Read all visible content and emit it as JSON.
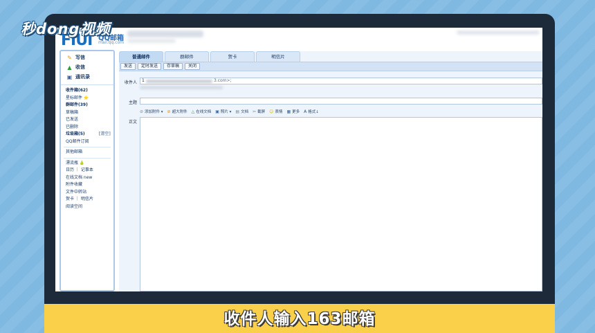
{
  "watermark": "秒dong视频",
  "header": {
    "logo_text": "FIUI",
    "logo_qq": "QQ邮箱",
    "logo_domain": "mail.qq.com"
  },
  "sidebar": {
    "actions": [
      {
        "label": "写信",
        "icon": "pen-icon"
      },
      {
        "label": "收信",
        "icon": "inbox-icon"
      },
      {
        "label": "通讯录",
        "icon": "contacts-icon"
      }
    ],
    "items": [
      {
        "label": "收件箱(62)",
        "bold": true
      },
      {
        "label": "星标邮件 ⭐",
        "bold": false
      },
      {
        "label": "群邮件(39)",
        "bold": true
      },
      {
        "label": "草稿箱",
        "bold": false
      },
      {
        "label": "已发送",
        "bold": false
      },
      {
        "label": "已删除",
        "bold": false
      },
      {
        "label": "垃圾箱(5)",
        "bold": true,
        "extra": "[清空]"
      },
      {
        "label": "QQ邮件订阅",
        "bold": false
      }
    ],
    "other_mailbox": "其他邮箱",
    "tools": [
      {
        "label": "漂流瓶 🍐"
      },
      {
        "label": "日历 ｜ 记事本"
      },
      {
        "label": "在线文档 new"
      },
      {
        "label": "附件收藏"
      },
      {
        "label": "文件中转站"
      },
      {
        "label": "贺卡 ｜ 明信片"
      },
      {
        "label": "阅读空间"
      }
    ]
  },
  "tabs": [
    "普通邮件",
    "群邮件",
    "贺卡",
    "明信片"
  ],
  "toolbar": {
    "send": "发送",
    "schedule": "定时发送",
    "save_draft": "存草稿",
    "close": "关闭"
  },
  "form": {
    "recipient_label": "收件人",
    "recipient_value": "1",
    "recipient_tail": "3.com>;",
    "subject_label": "主题",
    "body_label": "正文"
  },
  "format_bar": [
    {
      "label": "添加附件 ▾",
      "icon": "paperclip-icon",
      "color": "#7a8694"
    },
    {
      "label": "超大附件",
      "icon": "large-attachment-icon",
      "color": "#de8a1a"
    },
    {
      "label": "在线文档",
      "icon": "document-icon",
      "color": "#2f9b34"
    },
    {
      "label": "照片 ▾",
      "icon": "photo-icon",
      "color": "#3a63a8"
    },
    {
      "label": "文档",
      "icon": "file-icon",
      "color": "#7a8694"
    },
    {
      "label": "截屏",
      "icon": "screenshot-icon",
      "color": "#7a8694"
    },
    {
      "label": "表情",
      "icon": "emoji-icon",
      "color": "#e2b700"
    },
    {
      "label": "更多",
      "icon": "more-icon",
      "color": "#3a63a8"
    },
    {
      "label": "格式↓",
      "icon": "format-icon",
      "color": "#2b4770"
    }
  ],
  "caption": "收件人输入163邮箱",
  "colors": {
    "background": "#7fb9e2",
    "caption_band": "#fad04a",
    "sidebar_border": "#a9c7ea",
    "toolbar": "#d3e3f5"
  }
}
